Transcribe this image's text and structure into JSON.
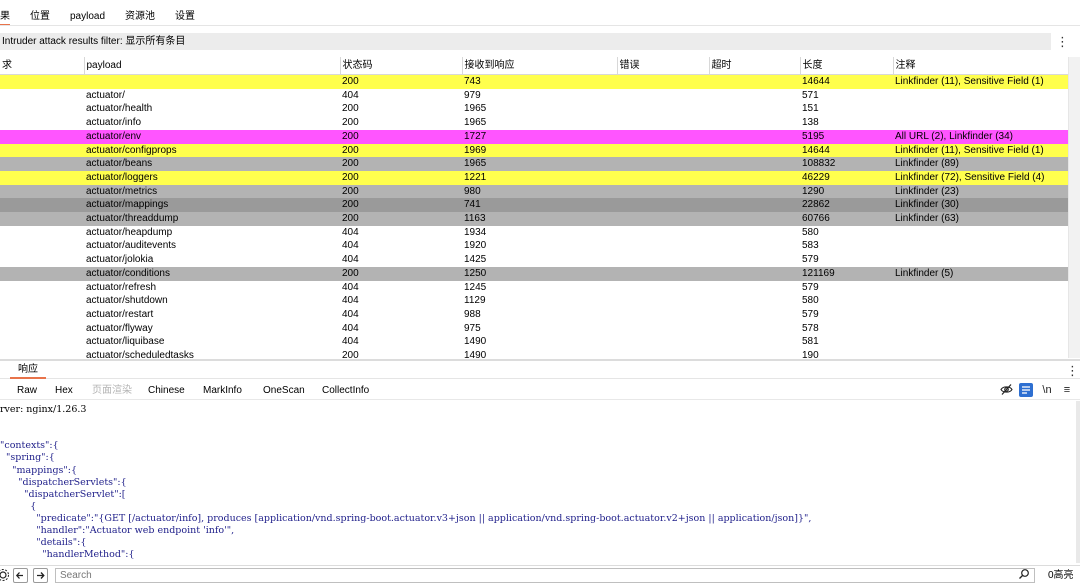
{
  "top_tabs": [
    "果",
    "位置",
    "payload",
    "资源池",
    "设置"
  ],
  "filter": {
    "text": "Intruder attack results filter: 显示所有条目"
  },
  "table": {
    "columns": [
      "求",
      "payload",
      "状态码",
      "接收到响应",
      "错误",
      "超时",
      "长度",
      "注释"
    ],
    "rows": [
      {
        "payload": "",
        "status": "200",
        "received": "743",
        "error": "",
        "timeout": "",
        "length": "14644",
        "comment": "Linkfinder (11), Sensitive Field (1)",
        "bg": "#ffff4d"
      },
      {
        "payload": "actuator/",
        "status": "404",
        "received": "979",
        "error": "",
        "timeout": "",
        "length": "571",
        "comment": "",
        "bg": "#ffffff"
      },
      {
        "payload": "actuator/health",
        "status": "200",
        "received": "1965",
        "error": "",
        "timeout": "",
        "length": "151",
        "comment": "",
        "bg": "#ffffff"
      },
      {
        "payload": "actuator/info",
        "status": "200",
        "received": "1965",
        "error": "",
        "timeout": "",
        "length": "138",
        "comment": "",
        "bg": "#ffffff"
      },
      {
        "payload": "actuator/env",
        "status": "200",
        "received": "1727",
        "error": "",
        "timeout": "",
        "length": "5195",
        "comment": "All URL (2), Linkfinder (34)",
        "bg": "#ff55ff"
      },
      {
        "payload": "actuator/configprops",
        "status": "200",
        "received": "1969",
        "error": "",
        "timeout": "",
        "length": "14644",
        "comment": "Linkfinder (11), Sensitive Field (1)",
        "bg": "#ffff4d"
      },
      {
        "payload": "actuator/beans",
        "status": "200",
        "received": "1965",
        "error": "",
        "timeout": "",
        "length": "108832",
        "comment": "Linkfinder (89)",
        "bg": "#b3b3b3"
      },
      {
        "payload": "actuator/loggers",
        "status": "200",
        "received": "1221",
        "error": "",
        "timeout": "",
        "length": "46229",
        "comment": "Linkfinder (72), Sensitive Field (4)",
        "bg": "#ffff4d"
      },
      {
        "payload": "actuator/metrics",
        "status": "200",
        "received": "980",
        "error": "",
        "timeout": "",
        "length": "1290",
        "comment": "Linkfinder (23)",
        "bg": "#b3b3b3"
      },
      {
        "payload": "actuator/mappings",
        "status": "200",
        "received": "741",
        "error": "",
        "timeout": "",
        "length": "22862",
        "comment": "Linkfinder (30)",
        "bg": "#9a9a9a"
      },
      {
        "payload": "actuator/threaddump",
        "status": "200",
        "received": "1163",
        "error": "",
        "timeout": "",
        "length": "60766",
        "comment": "Linkfinder (63)",
        "bg": "#b3b3b3"
      },
      {
        "payload": "actuator/heapdump",
        "status": "404",
        "received": "1934",
        "error": "",
        "timeout": "",
        "length": "580",
        "comment": "",
        "bg": "#ffffff"
      },
      {
        "payload": "actuator/auditevents",
        "status": "404",
        "received": "1920",
        "error": "",
        "timeout": "",
        "length": "583",
        "comment": "",
        "bg": "#ffffff"
      },
      {
        "payload": "actuator/jolokia",
        "status": "404",
        "received": "1425",
        "error": "",
        "timeout": "",
        "length": "579",
        "comment": "",
        "bg": "#ffffff"
      },
      {
        "payload": "actuator/conditions",
        "status": "200",
        "received": "1250",
        "error": "",
        "timeout": "",
        "length": "121169",
        "comment": "Linkfinder (5)",
        "bg": "#b3b3b3"
      },
      {
        "payload": "actuator/refresh",
        "status": "404",
        "received": "1245",
        "error": "",
        "timeout": "",
        "length": "579",
        "comment": "",
        "bg": "#ffffff"
      },
      {
        "payload": "actuator/shutdown",
        "status": "404",
        "received": "1129",
        "error": "",
        "timeout": "",
        "length": "580",
        "comment": "",
        "bg": "#ffffff"
      },
      {
        "payload": "actuator/restart",
        "status": "404",
        "received": "988",
        "error": "",
        "timeout": "",
        "length": "579",
        "comment": "",
        "bg": "#ffffff"
      },
      {
        "payload": "actuator/flyway",
        "status": "404",
        "received": "975",
        "error": "",
        "timeout": "",
        "length": "578",
        "comment": "",
        "bg": "#ffffff"
      },
      {
        "payload": "actuator/liquibase",
        "status": "404",
        "received": "1490",
        "error": "",
        "timeout": "",
        "length": "581",
        "comment": "",
        "bg": "#ffffff"
      },
      {
        "payload": "actuator/scheduledtasks",
        "status": "200",
        "received": "1490",
        "error": "",
        "timeout": "",
        "length": "190",
        "comment": "",
        "bg": "#ffffff"
      }
    ]
  },
  "response": {
    "tab": "响应",
    "subtabs": [
      "Raw",
      "Hex",
      "页面渲染",
      "Chinese",
      "MarkInfo",
      "OneScan",
      "CollectInfo"
    ],
    "tool_icons": [
      "eye-off-icon",
      "wrap-lines-icon",
      "newline-icon",
      "menu-icon"
    ],
    "newline_label": "\\n",
    "code_lines": [
      "rver: nginx/1.26.3",
      "",
      "",
      "\"contexts\":{",
      "  \"spring\":{",
      "    \"mappings\":{",
      "      \"dispatcherServlets\":{",
      "        \"dispatcherServlet\":[",
      "          {",
      "            \"predicate\":\"{GET [/actuator/info], produces [application/vnd.spring-boot.actuator.v3+json || application/vnd.spring-boot.actuator.v2+json || application/json]}\",",
      "            \"handler\":\"Actuator web endpoint 'info'\",",
      "            \"details\":{",
      "              \"handlerMethod\":{"
    ]
  },
  "bottom": {
    "search_placeholder": "Search",
    "highlight_count": "0高亮"
  },
  "colors": {
    "accent": "#e8734a",
    "yellow_highlight": "#ffff4d",
    "magenta_highlight": "#ff55ff",
    "gray_highlight": "#b3b3b3",
    "dark_gray_highlight": "#9a9a9a"
  }
}
